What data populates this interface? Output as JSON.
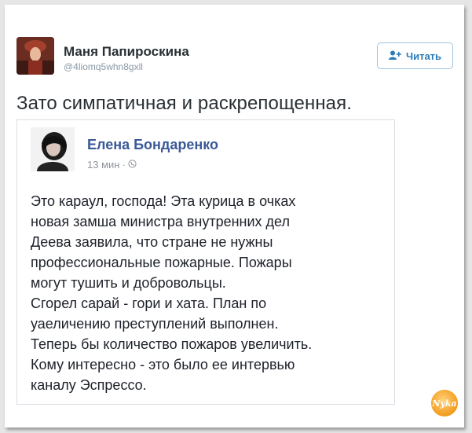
{
  "tweet": {
    "author_name": "Маня Папироскина",
    "author_handle": "@4liomq5whn8gxll",
    "follow_label": "Читать",
    "text": "Зато симпатичная и раскрепощенная."
  },
  "quoted_post": {
    "author_name": "Елена Бондаренко",
    "time": "13 мин",
    "separator": "·",
    "body_lines": [
      "Это караул, господа! Эта курица в очках",
      "новая замша министра внутренних дел",
      "Деева заявила, что стране не нужны",
      "профессиональные пожарные. Пожары",
      "могут тушить и добровольцы.",
      "Сгорел сарай - гори и хата. План по",
      "уаеличению преступлений выполнен.",
      "Теперь бы количество пожаров увеличить.",
      "Кому интересно - это было ее интервью",
      "каналу Эспрессо."
    ]
  },
  "watermark": {
    "text": "Nyka"
  },
  "colors": {
    "twitter_blue": "#2b7bb9",
    "facebook_blue": "#3b5998",
    "logo_orange": "#f29b1d"
  }
}
